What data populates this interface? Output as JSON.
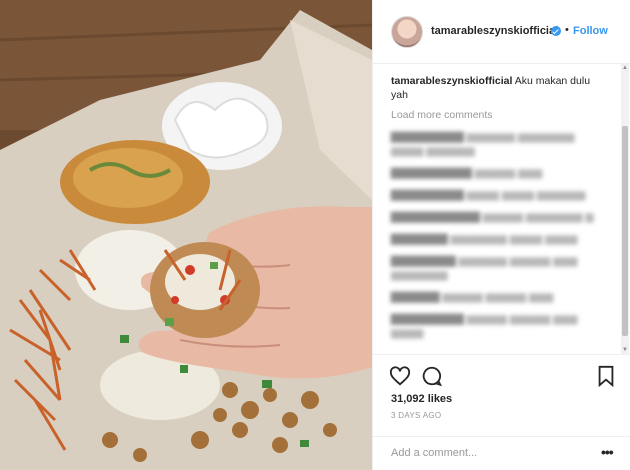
{
  "post": {
    "username": "tamarableszynskiofficial",
    "separator": "•",
    "follow_label": "Follow",
    "caption": {
      "user": "tamarableszynskiofficial",
      "text": "Aku makan dulu yah"
    },
    "load_more_label": "Load more comments",
    "likes": "31,092 likes",
    "timestamp": "3 DAYS AGO",
    "comment_placeholder": "Add a comment...",
    "more_label": "•••",
    "accent_color": "#3897f0"
  },
  "icons": [
    "verified-badge-icon",
    "heart-icon",
    "comment-icon",
    "bookmark-icon",
    "more-options-icon"
  ]
}
